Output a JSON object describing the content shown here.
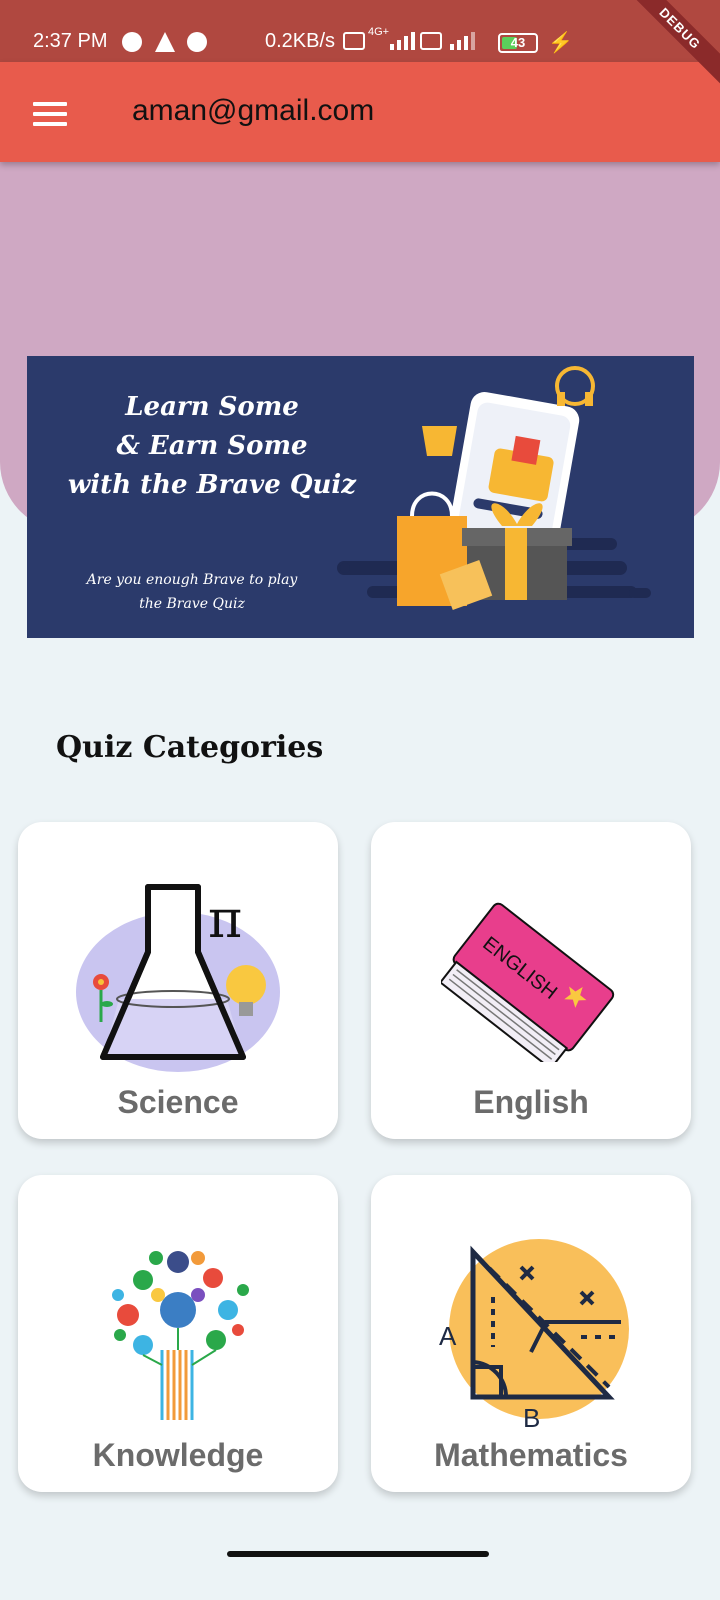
{
  "status_bar": {
    "time": "2:37 PM",
    "network_speed": "0.2KB/s",
    "network_type": "4G+",
    "battery_level": "43",
    "debug_banner": "DEBUG"
  },
  "app_bar": {
    "title": "aman@gmail.com"
  },
  "banner": {
    "title_line1": "Learn Some",
    "title_line2": "& Earn Some",
    "title_line3": "with the Brave Quiz",
    "subtitle_line1": "Are you enough Brave to play",
    "subtitle_line2": "the Brave Quiz"
  },
  "section": {
    "title": "Quiz Categories"
  },
  "categories": [
    {
      "label": "Science",
      "icon": "science-flask-icon"
    },
    {
      "label": "English",
      "icon": "english-book-icon"
    },
    {
      "label": "Knowledge",
      "icon": "knowledge-tree-icon"
    },
    {
      "label": "Mathematics",
      "icon": "mathematics-geometry-icon"
    }
  ],
  "pi_symbol": "π",
  "math_letters": {
    "a": "A",
    "b": "B"
  },
  "english_book_text": "ENGLISH",
  "colors": {
    "status_bar": "#b04840",
    "app_bar": "#e85b4c",
    "hero": "#cfa8c3",
    "banner": "#2b3a6b",
    "background": "#ecf3f6",
    "card_label": "#6b6b6b"
  }
}
